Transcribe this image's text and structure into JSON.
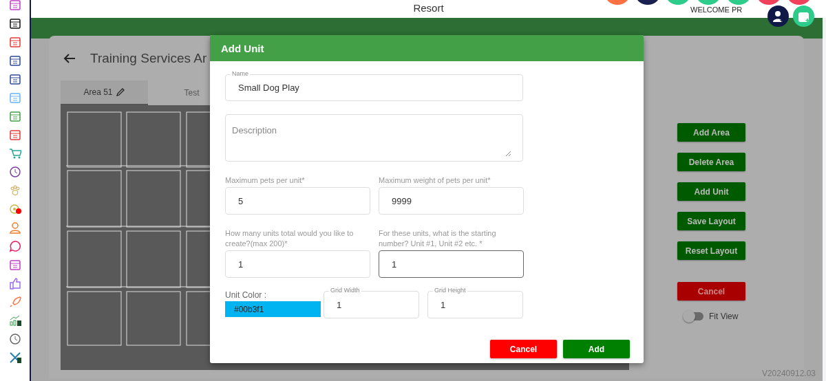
{
  "header": {
    "title": "Resort",
    "welcome": "WELCOME PR"
  },
  "page": {
    "title": "Training Services Ar"
  },
  "tabs": [
    {
      "label": "Area 51",
      "selected": true,
      "editable": true
    },
    {
      "label": "Test",
      "selected": false,
      "editable": false
    }
  ],
  "actions": [
    {
      "label": "Add Area",
      "kind": "primary"
    },
    {
      "label": "Delete Area",
      "kind": "primary"
    },
    {
      "label": "Add Unit",
      "kind": "primary"
    },
    {
      "label": "Save Layout",
      "kind": "primary"
    },
    {
      "label": "Reset Layout",
      "kind": "primary"
    },
    {
      "label": "Cancel",
      "kind": "danger"
    }
  ],
  "fit_view": {
    "label": "Fit View",
    "on": false
  },
  "version": "V20240912.03",
  "dialog": {
    "title": "Add Unit",
    "name": {
      "label": "Name",
      "value": "Small Dog Play"
    },
    "description": {
      "placeholder": "Description"
    },
    "fields": [
      {
        "label": "Maximum pets per unit*",
        "value": "5",
        "focused": false
      },
      {
        "label": "Maximum weight of pets per unit*",
        "value": "9999",
        "focused": false
      },
      {
        "label": "How many units total would you like to create?(max 200)*",
        "value": "1",
        "focused": false
      },
      {
        "label": "For these units, what is the starting number? Unit #1, Unit #2 etc. *",
        "value": "1",
        "focused": true
      }
    ],
    "unit_color": {
      "label": "Unit Color :",
      "value": "#00b3f1",
      "color": "#00b3f1"
    },
    "grid_width": {
      "label": "Grid Width",
      "value": "1"
    },
    "grid_height": {
      "label": "Grid Height",
      "value": "1"
    },
    "buttons": [
      {
        "label": "Cancel",
        "kind": "danger"
      },
      {
        "label": "Add",
        "kind": "primary"
      }
    ]
  }
}
